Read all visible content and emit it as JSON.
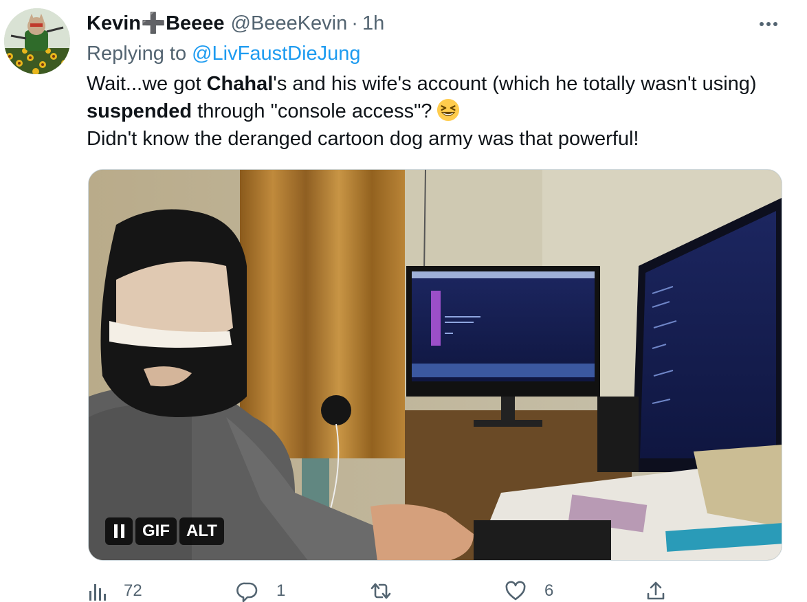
{
  "tweet": {
    "display_name": "Kevin➕Beeee",
    "handle": "@BeeeKevin",
    "separator": "·",
    "time": "1h",
    "replying_prefix": "Replying to",
    "replying_to": "@LivFaustDieJung",
    "text": {
      "p1": "Wait...we got ",
      "b1": "Chahal",
      "p2": "'s and his wife's account (which he totally wasn't using) ",
      "b2": "suspended",
      "p3": " through \"console access\"?",
      "line2": "Didn't know the deranged cartoon dog army was that powerful!"
    },
    "emoji": "grinning-squinting-face-emoji",
    "media": {
      "type": "gif",
      "pause_label": "pause",
      "gif_label": "GIF",
      "alt_label": "ALT"
    }
  },
  "actions": {
    "views_count": "72",
    "reply_count": "1",
    "retweet_count": "",
    "like_count": "6"
  },
  "colors": {
    "link": "#1d9bf0",
    "secondary_text": "#536471",
    "primary_text": "#0f1419"
  }
}
